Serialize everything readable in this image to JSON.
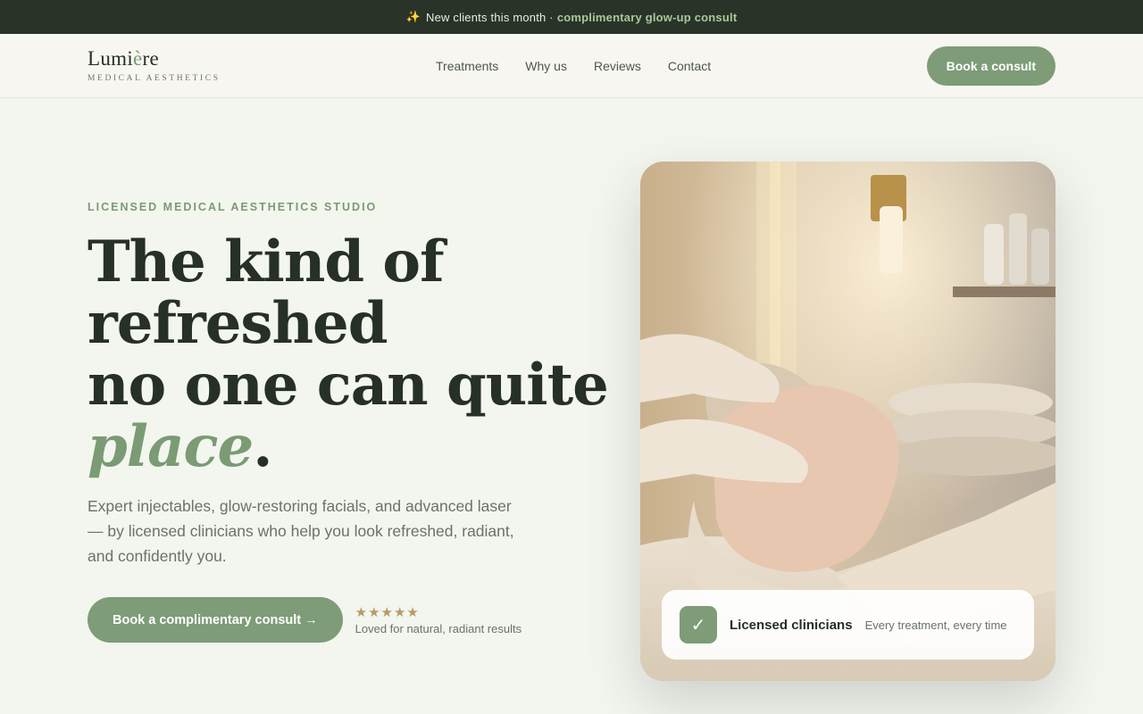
{
  "announcement": {
    "icon": "sparkles-icon",
    "text": "New clients this month ·",
    "highlight": "complimentary glow-up consult"
  },
  "nav": {
    "logo": {
      "name_pre": "Lumi",
      "name_accent": "è",
      "name_post": "re",
      "subtitle": "MEDICAL AESTHETICS"
    },
    "links": [
      "Treatments",
      "Why us",
      "Reviews",
      "Contact"
    ],
    "cta": "Book a consult"
  },
  "hero": {
    "eyebrow": "LICENSED MEDICAL AESTHETICS STUDIO",
    "headline": {
      "line1": "The kind of",
      "line2": "refreshed",
      "line3": "no one can quite",
      "emphasis": "place",
      "period": "."
    },
    "lede": "Expert injectables, glow-restoring facials, and advanced laser — by licensed clinicians who help you look refreshed, radiant, and confidently you.",
    "cta": "Book a complimentary consult →",
    "rating": {
      "stars": "★★★★★",
      "text": "Loved for natural, radiant results"
    }
  },
  "photo_badge": {
    "icon": "check-icon",
    "title": "Licensed clinicians",
    "subtitle": "Every treatment, every time"
  },
  "colors": {
    "accent": "#7d9c77",
    "dark": "#2a3328",
    "background": "#f3f5ef",
    "star": "#b89a62"
  }
}
